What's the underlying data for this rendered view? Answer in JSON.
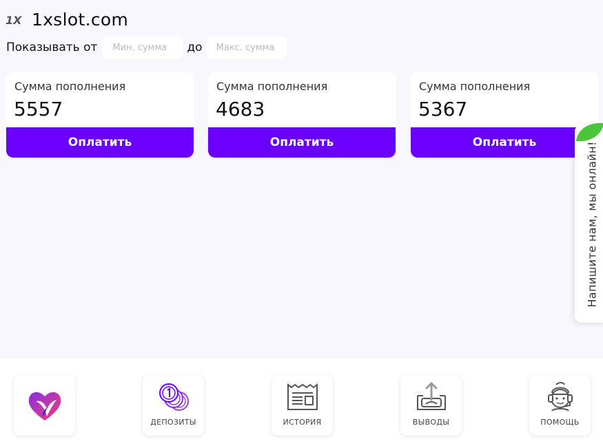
{
  "header": {
    "brand_mark": "1X",
    "site_name": "1xslot.com"
  },
  "filter": {
    "label_from": "Показывать от",
    "min_placeholder": "Мин. сумма",
    "label_to": "до",
    "max_placeholder": "Макс. сумма"
  },
  "cards": [
    {
      "title": "Сумма пополнения",
      "amount": "5557",
      "button": "Оплатить"
    },
    {
      "title": "Сумма пополнения",
      "amount": "4683",
      "button": "Оплатить"
    },
    {
      "title": "Сумма пополнения",
      "amount": "5367",
      "button": "Оплатить"
    }
  ],
  "chat": {
    "label": "Напишите нам, мы онлайн!"
  },
  "nav": {
    "logo_icon": "heart-bird-logo",
    "items": [
      {
        "label": "ДЕПОЗИТЫ",
        "icon": "coins-icon"
      },
      {
        "label": "ИСТОРИЯ",
        "icon": "receipt-icon"
      },
      {
        "label": "ВЫВОДЫ",
        "icon": "withdraw-icon"
      },
      {
        "label": "ПОМОЩЬ",
        "icon": "support-agent-icon"
      }
    ]
  },
  "colors": {
    "accent": "#6a00ff",
    "background": "#f7f7fd",
    "chat_leaf": "#4cc43a"
  }
}
